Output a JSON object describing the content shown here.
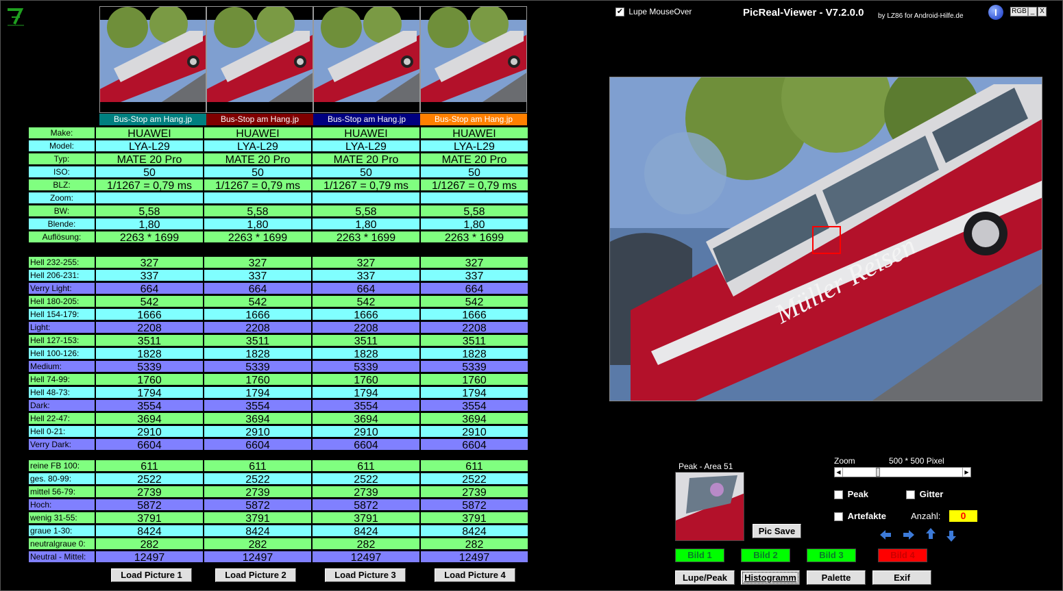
{
  "app": {
    "title": "PicReal-Viewer - V7.2.0.0",
    "subtitle": "by LZ86 for Android-Hilfe.de",
    "lupe_label": "Lupe MouseOver",
    "lupe_checked": true,
    "rgb_label": "RGB",
    "minimize_label": "_",
    "close_label": "X",
    "info_label": "I"
  },
  "pictures": [
    {
      "title": "Bus-Stop am Hang.jp",
      "color": "#008080",
      "load_label": "Load Picture 1"
    },
    {
      "title": "Bus-Stop am Hang.jp",
      "color": "#800000",
      "load_label": "Load Picture 2"
    },
    {
      "title": "Bus-Stop am Hang.jp",
      "color": "#000080",
      "load_label": "Load Picture 3"
    },
    {
      "title": "Bus-Stop am Hang.jp",
      "color": "#ff8000",
      "load_label": "Load Picture 4"
    }
  ],
  "exif_rows": [
    {
      "label": "Make:",
      "values": [
        "HUAWEI",
        "HUAWEI",
        "HUAWEI",
        "HUAWEI"
      ]
    },
    {
      "label": "Model:",
      "values": [
        "LYA-L29",
        "LYA-L29",
        "LYA-L29",
        "LYA-L29"
      ]
    },
    {
      "label": "Typ:",
      "values": [
        "MATE 20 Pro",
        "MATE 20 Pro",
        "MATE 20 Pro",
        "MATE 20 Pro"
      ]
    },
    {
      "label": "ISO:",
      "values": [
        "50",
        "50",
        "50",
        "50"
      ]
    },
    {
      "label": "BLZ:",
      "values": [
        "1/1267 = 0,79 ms",
        "1/1267 = 0,79 ms",
        "1/1267 = 0,79 ms",
        "1/1267 = 0,79 ms"
      ]
    },
    {
      "label": "Zoom:",
      "values": [
        "",
        "",
        "",
        ""
      ]
    },
    {
      "label": "BW:",
      "values": [
        "5,58",
        "5,58",
        "5,58",
        "5,58"
      ]
    },
    {
      "label": "Blende:",
      "values": [
        "1,80",
        "1,80",
        "1,80",
        "1,80"
      ]
    },
    {
      "label": "Auflösung:",
      "values": [
        "2263 * 1699",
        "2263 * 1699",
        "2263 * 1699",
        "2263 * 1699"
      ]
    }
  ],
  "brightness_rows": [
    {
      "label": "Hell 232-255:",
      "values": [
        "327",
        "327",
        "327",
        "327"
      ]
    },
    {
      "label": "Hell 206-231:",
      "values": [
        "337",
        "337",
        "337",
        "337"
      ]
    },
    {
      "label": "Verry Light:",
      "values": [
        "664",
        "664",
        "664",
        "664"
      ]
    },
    {
      "label": "Hell 180-205:",
      "values": [
        "542",
        "542",
        "542",
        "542"
      ]
    },
    {
      "label": "Hell 154-179:",
      "values": [
        "1666",
        "1666",
        "1666",
        "1666"
      ]
    },
    {
      "label": "Light:",
      "values": [
        "2208",
        "2208",
        "2208",
        "2208"
      ]
    },
    {
      "label": "Hell 127-153:",
      "values": [
        "3511",
        "3511",
        "3511",
        "3511"
      ]
    },
    {
      "label": "Hell 100-126:",
      "values": [
        "1828",
        "1828",
        "1828",
        "1828"
      ]
    },
    {
      "label": "Medium:",
      "values": [
        "5339",
        "5339",
        "5339",
        "5339"
      ]
    },
    {
      "label": "Hell 74-99:",
      "values": [
        "1760",
        "1760",
        "1760",
        "1760"
      ]
    },
    {
      "label": "Hell 48-73:",
      "values": [
        "1794",
        "1794",
        "1794",
        "1794"
      ]
    },
    {
      "label": "Dark:",
      "values": [
        "3554",
        "3554",
        "3554",
        "3554"
      ]
    },
    {
      "label": "Hell 22-47:",
      "values": [
        "3694",
        "3694",
        "3694",
        "3694"
      ]
    },
    {
      "label": "Hell 0-21:",
      "values": [
        "2910",
        "2910",
        "2910",
        "2910"
      ]
    },
    {
      "label": "Verry Dark:",
      "values": [
        "6604",
        "6604",
        "6604",
        "6604"
      ]
    }
  ],
  "color_rows": [
    {
      "label": "reine FB 100:",
      "values": [
        "611",
        "611",
        "611",
        "611"
      ]
    },
    {
      "label": "ges. 80-99:",
      "values": [
        "2522",
        "2522",
        "2522",
        "2522"
      ]
    },
    {
      "label": "mittel 56-79:",
      "values": [
        "2739",
        "2739",
        "2739",
        "2739"
      ]
    },
    {
      "label": "Hoch:",
      "values": [
        "5872",
        "5872",
        "5872",
        "5872"
      ]
    },
    {
      "label": "wenig 31-55:",
      "values": [
        "3791",
        "3791",
        "3791",
        "3791"
      ]
    },
    {
      "label": "graue  1-30:",
      "values": [
        "8424",
        "8424",
        "8424",
        "8424"
      ]
    },
    {
      "label": "neutralgraue 0:",
      "values": [
        "282",
        "282",
        "282",
        "282"
      ]
    },
    {
      "label": "Neutral - Mittel:",
      "values": [
        "12497",
        "12497",
        "12497",
        "12497"
      ]
    }
  ],
  "controls": {
    "peak_area_label": "Peak - Area 51",
    "pic_save_label": "Pic Save",
    "zoom_label": "Zoom",
    "zoom_value": "500 * 500 Pixel",
    "peak_label": "Peak",
    "gitter_label": "Gitter",
    "artefakte_label": "Artefakte",
    "anzahl_label": "Anzahl:",
    "anzahl_value": "0",
    "bild_buttons": [
      {
        "label": "Bild 1",
        "color": "#00ff00"
      },
      {
        "label": "Bild 2",
        "color": "#00ff00"
      },
      {
        "label": "Bild 3",
        "color": "#00ff00"
      },
      {
        "label": "Bild 4",
        "color": "#ff0000"
      }
    ],
    "lupe_peak_label": "Lupe/Peak",
    "histogramm_label": "Histogramm",
    "palette_label": "Palette",
    "exif_label": "Exif"
  }
}
